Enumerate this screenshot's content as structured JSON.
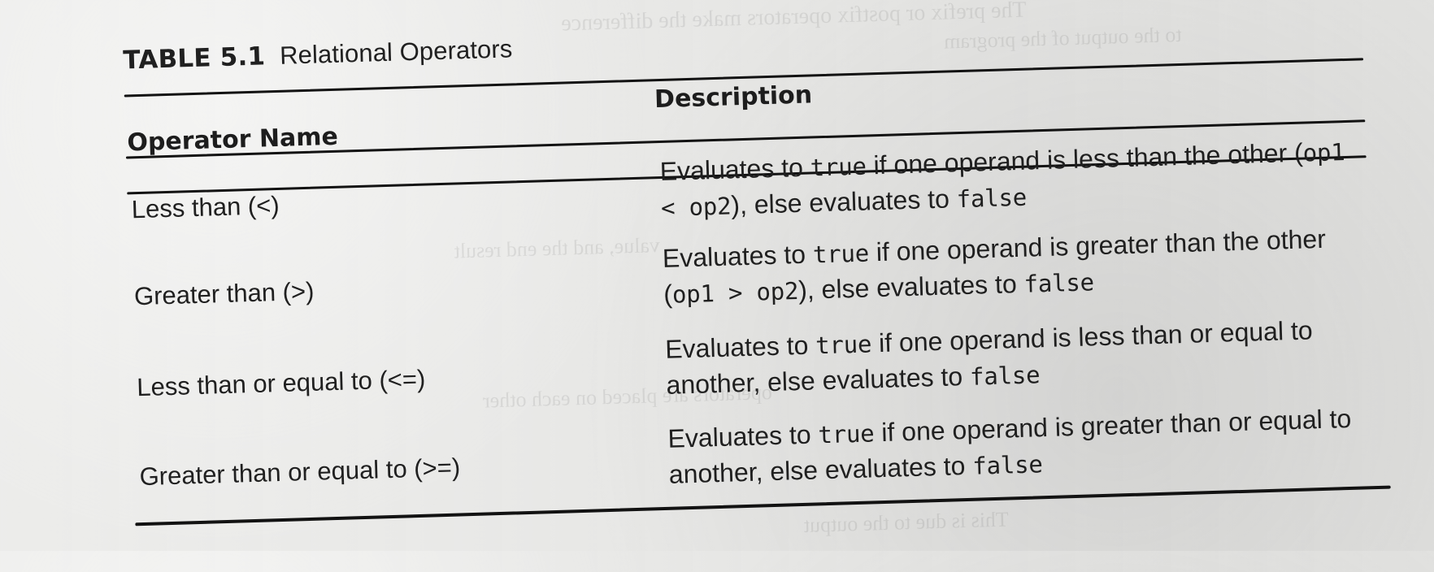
{
  "table": {
    "number": "TABLE 5.1",
    "title": "Relational Operators",
    "headers": {
      "operator_name": "Operator Name",
      "description": "Description"
    },
    "rows": [
      {
        "name": "Less than (<)",
        "description": {
          "prefix": "Evaluates to ",
          "true_keyword": "true",
          "middle": " if one operand is less than the other (",
          "expression": "op1 < op2",
          "suffix": "), else evaluates to ",
          "false_keyword": "false"
        }
      },
      {
        "name": "Greater than (>)",
        "description": {
          "prefix": "Evaluates to ",
          "true_keyword": "true",
          "middle": " if one operand is greater than the other (",
          "expression": "op1 > op2",
          "suffix": "), else evaluates to ",
          "false_keyword": "false"
        }
      },
      {
        "name": "Less than or equal to (<=)",
        "description": {
          "prefix": "Evaluates to ",
          "true_keyword": "true",
          "middle": " if one operand is less than or equal to another, else evaluates to ",
          "false_keyword": "false"
        }
      },
      {
        "name": "Greater than or equal to (>=)",
        "description": {
          "prefix": "Evaluates to ",
          "true_keyword": "true",
          "middle": " if one operand is greater than or equal to another, else evaluates to ",
          "false_keyword": "false"
        }
      }
    ]
  }
}
